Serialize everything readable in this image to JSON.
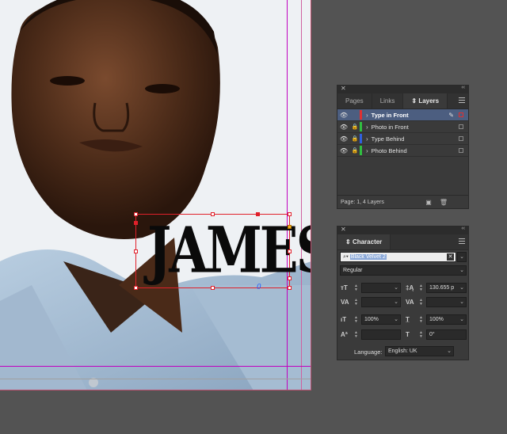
{
  "canvas": {
    "word": "JAMES",
    "overset_glyph": "0"
  },
  "layers_panel": {
    "tabs": [
      "Pages",
      "Links",
      "Layers"
    ],
    "active_tab_icon": "updown-arrows-icon",
    "layers": [
      {
        "name": "Type in Front",
        "color": "#e03030",
        "visible": true,
        "locked": false,
        "selected": true
      },
      {
        "name": "Photo in Front",
        "color": "#30c040",
        "visible": true,
        "locked": true,
        "selected": false
      },
      {
        "name": "Type Behind",
        "color": "#3060e0",
        "visible": true,
        "locked": true,
        "selected": false
      },
      {
        "name": "Photo Behind",
        "color": "#30c040",
        "visible": true,
        "locked": true,
        "selected": false
      }
    ],
    "footer_text": "Page: 1, 4 Layers"
  },
  "character_panel": {
    "title": "Character",
    "font_family": "Black Velvet 2",
    "font_style": "Regular",
    "font_size": "",
    "leading": "130.655 p",
    "kerning": "",
    "tracking": "",
    "vertical_scale": "100%",
    "horizontal_scale": "100%",
    "baseline_shift": "",
    "skew": "0°",
    "language_label": "Language:",
    "language_value": "English: UK"
  },
  "colors": {
    "panel_bg": "#3a3a3a",
    "selection": "#4c5e80",
    "frame_red": "#e0202a"
  }
}
